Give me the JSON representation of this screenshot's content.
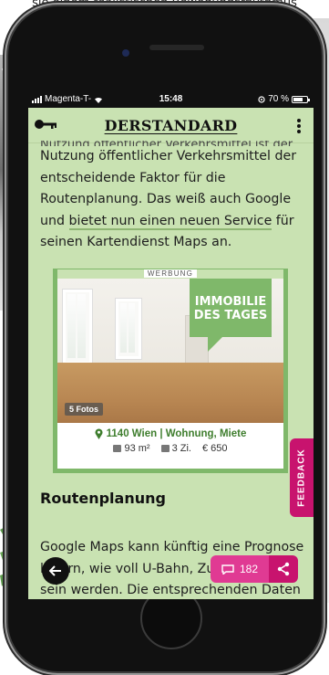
{
  "background": {
    "caption": "sie einem realistischen Bewegungsrhythmus",
    "left_text": "v"
  },
  "status_bar": {
    "carrier": "Magenta-T-",
    "time": "15:48",
    "battery": "70 %",
    "battery_level": 0.7
  },
  "header": {
    "logo": "DERSTANDARD",
    "key_icon": "key-icon",
    "menu_icon": "more-vertical-icon"
  },
  "article": {
    "cut_line": "Nutzung öffentlicher Verkehrsmittel ist der",
    "paragraph_1_start": "Nutzung öffentlicher Verkehrsmittel der entscheidende Faktor für die Routenplanung. Das weiß auch Google und ",
    "paragraph_1_link": "bietet nun einen neuen Service",
    "paragraph_1_end": " für seinen Kartendienst Maps an.",
    "section_title": "Routenplanung",
    "paragraph_2": "Google Maps kann künftig eine Prognose liefern, wie voll U-Bahn, Zug oder Bus sein werden. Die entsprechenden Daten werden den Nutzern bei der Routenplanung"
  },
  "ad": {
    "label": "WERBUNG",
    "badge_line_1": "IMMOBILIE",
    "badge_line_2": "DES TAGES",
    "photos": "5 Fotos",
    "location": "1140 Wien | Wohnung, Miete",
    "area": "93 m²",
    "rooms": "3 Zi.",
    "price": "€ 650",
    "badge_color": "#7fb86a"
  },
  "floating": {
    "feedback": "FEEDBACK",
    "comments_count": "182",
    "accent_color": "#c8136e"
  }
}
